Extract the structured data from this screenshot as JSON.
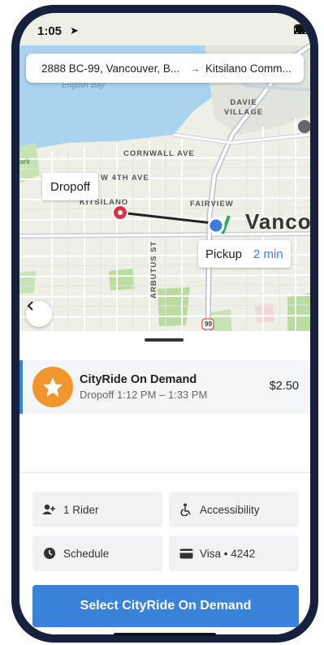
{
  "status": {
    "time": "1:05"
  },
  "route": {
    "from": "2888 BC-99, Vancouver, B...",
    "arrow": "→",
    "to": "Kitsilano Comm..."
  },
  "map": {
    "labels": {
      "english_bay": "English Bay",
      "davie_village": "DAVIE VILLAGE",
      "cornwall": "CORNWALL AVE",
      "w4th": "W 4TH AVE",
      "kitsilano": "KITSILANO",
      "fairview": "FAIRVIEW",
      "arbutus": "ARBUTUS ST",
      "park": "ark",
      "highway": "99",
      "city": "Vanco"
    },
    "dropoff_label": "Dropoff",
    "pickup_label": "Pickup",
    "pickup_eta": "2 min"
  },
  "ride_option": {
    "name": "CityRide On Demand",
    "dropoff_window": "Dropoff 1:12 PM – 1:33 PM",
    "price": "$2.50"
  },
  "chips": {
    "riders": "1 Rider",
    "accessibility": "Accessibility",
    "schedule": "Schedule",
    "payment": "Visa • 4242"
  },
  "cta": {
    "label": "Select CityRide On Demand"
  },
  "colors": {
    "accent": "#3a82dc",
    "brand_orange": "#f0962c",
    "dropoff_red": "#e03240",
    "pickup_blue": "#3a7de0"
  }
}
